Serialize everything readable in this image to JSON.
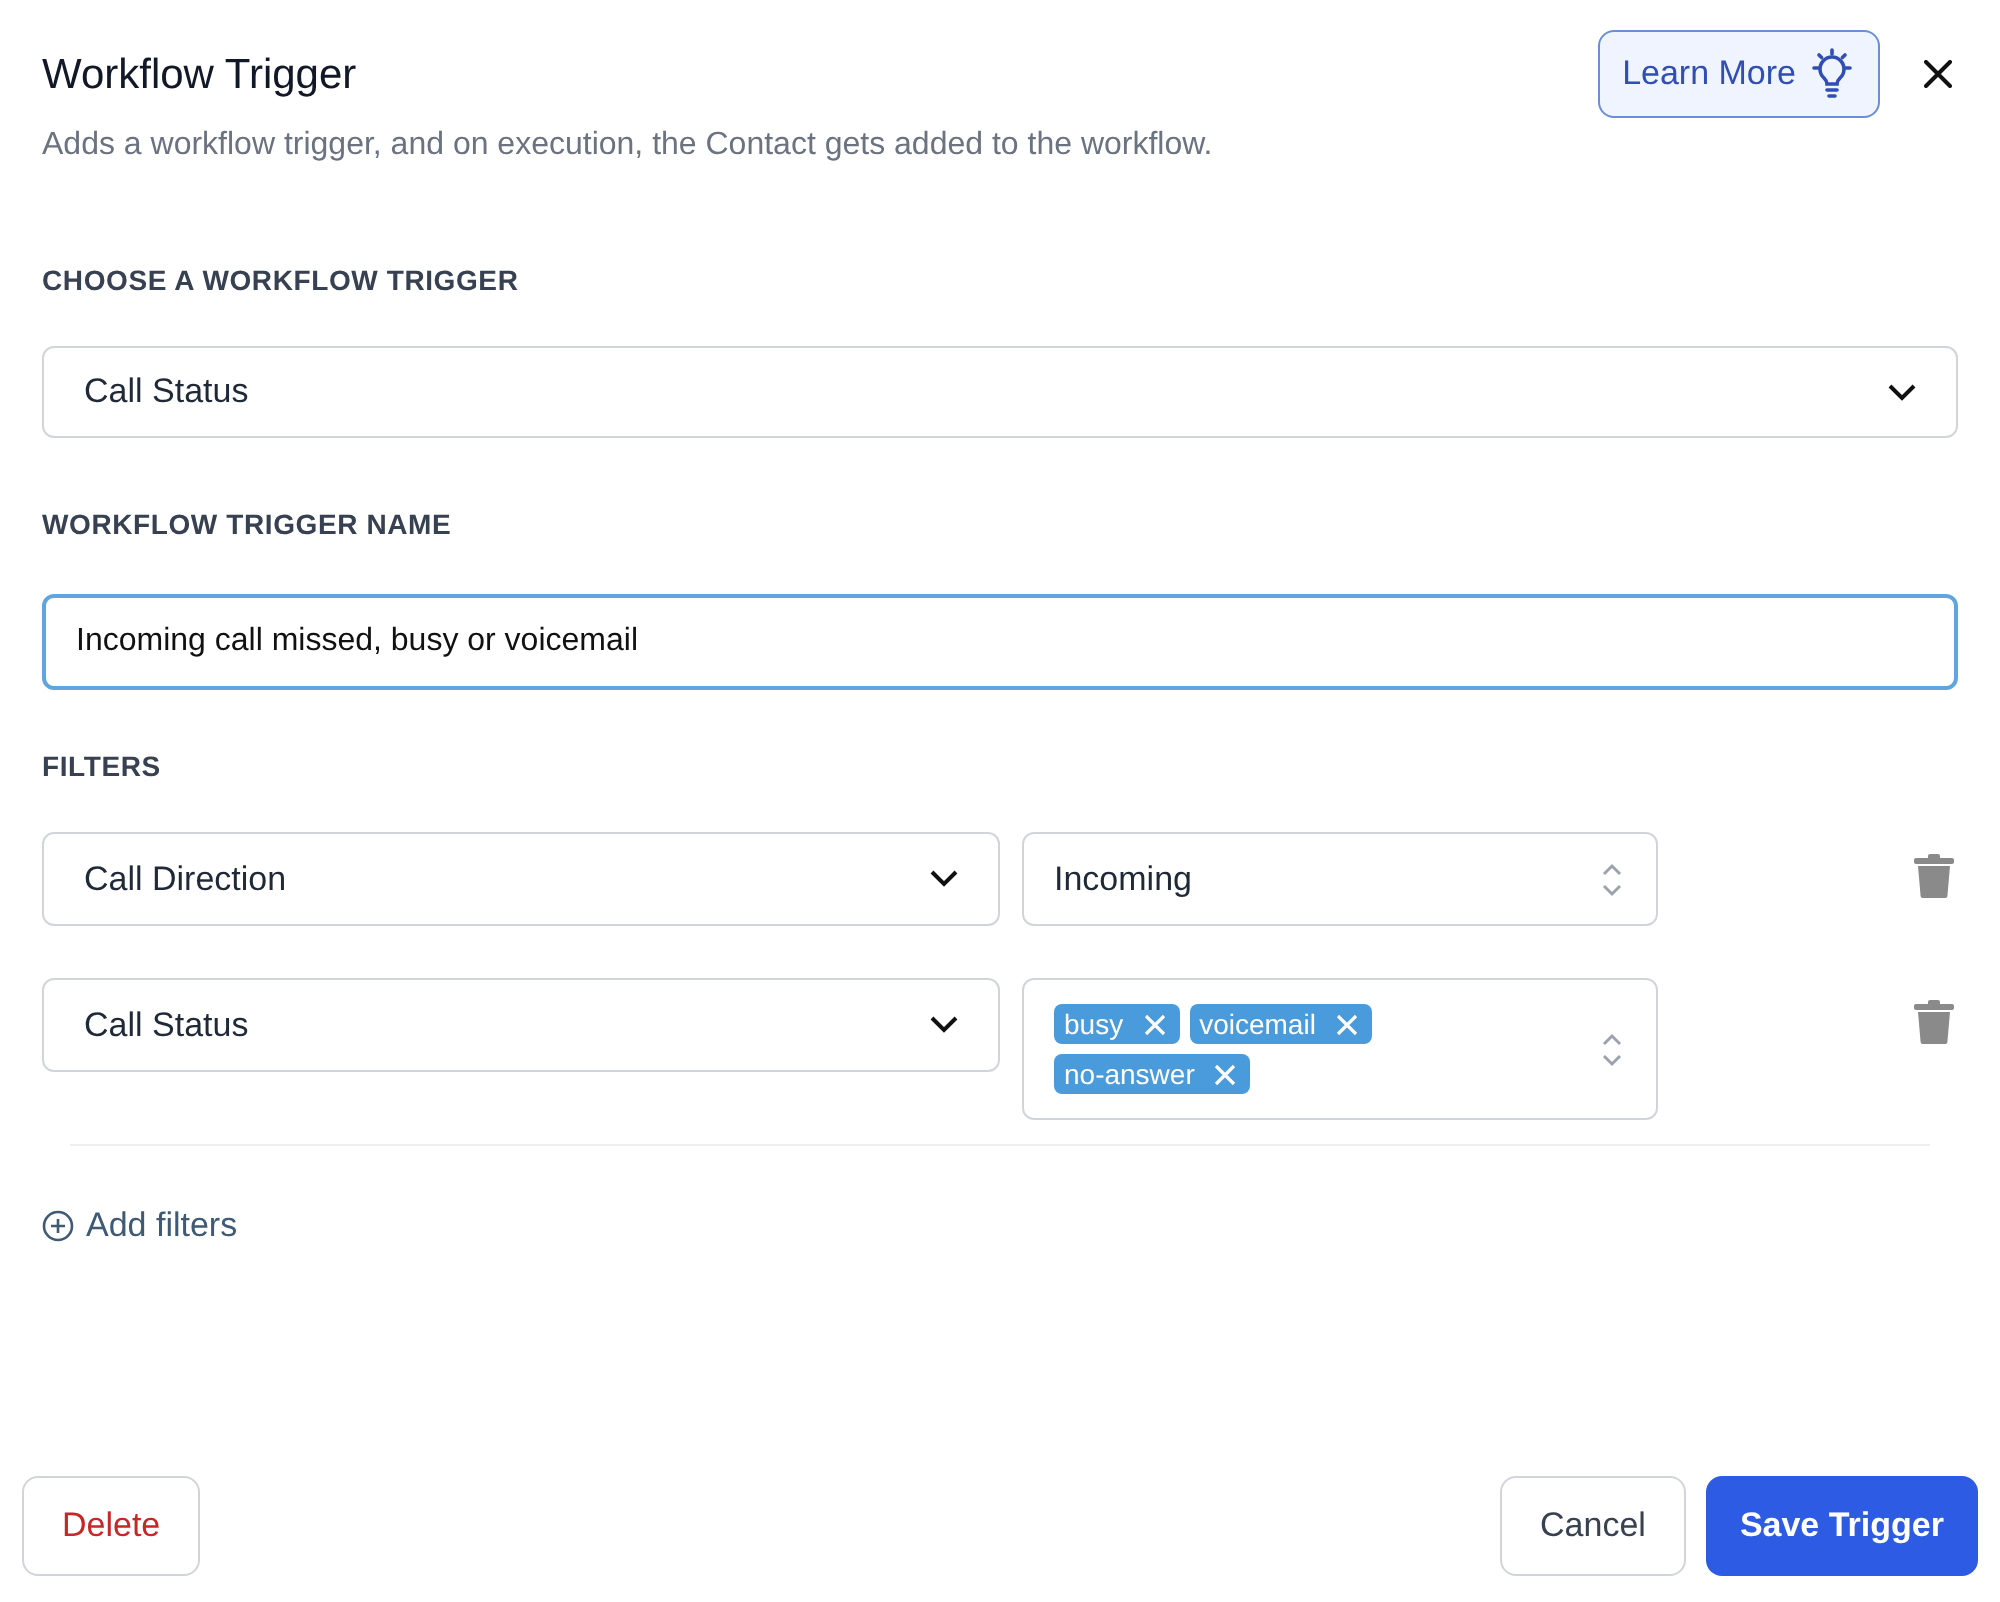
{
  "header": {
    "title": "Workflow Trigger",
    "subtitle": "Adds a workflow trigger, and on execution, the Contact gets added to the workflow.",
    "learn_more": "Learn More"
  },
  "trigger": {
    "label": "CHOOSE A WORKFLOW TRIGGER",
    "value": "Call Status"
  },
  "name": {
    "label": "WORKFLOW TRIGGER NAME",
    "value": "Incoming call missed, busy or voicemail",
    "focused": true
  },
  "filters": {
    "label": "FILTERS",
    "rows": [
      {
        "field": "Call Direction",
        "kind": "single",
        "value": "Incoming"
      },
      {
        "field": "Call Status",
        "kind": "tags",
        "tags": [
          "busy",
          "voicemail",
          "no-answer"
        ]
      }
    ],
    "add": "Add filters"
  },
  "footer": {
    "delete": "Delete",
    "cancel": "Cancel",
    "save": "Save Trigger"
  }
}
